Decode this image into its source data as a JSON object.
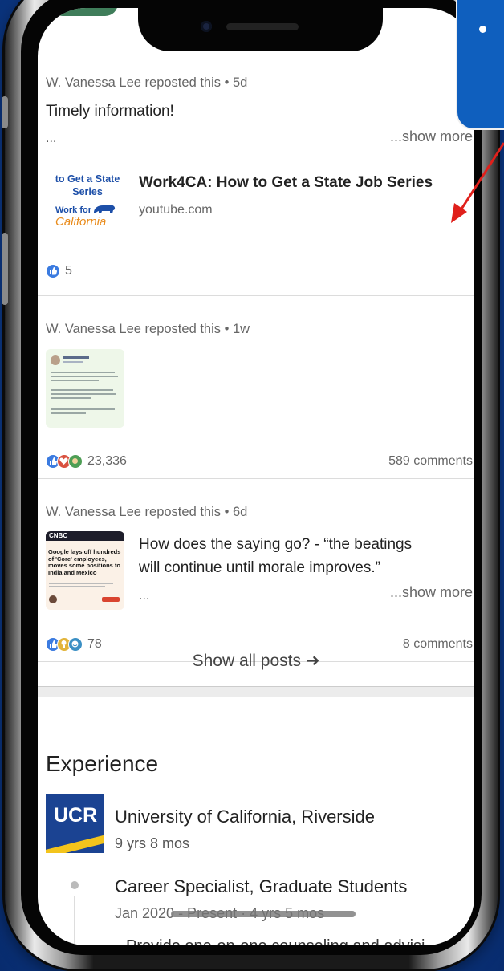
{
  "posts": [
    {
      "author": "W. Vanessa Lee",
      "action": "reposted this",
      "age": "• 5d",
      "text": "Timely information!",
      "ellipsis": "...",
      "show_more": "...show more",
      "link_title": "Work4CA: How to Get a State Job Series",
      "link_domain": "youtube.com",
      "thumb_line1": "to Get a State",
      "thumb_line2": "Series",
      "thumb_line3": "Work for",
      "thumb_line4": "California",
      "reaction_count": "5"
    },
    {
      "author": "W. Vanessa Lee",
      "action": "reposted this",
      "age": "• 1w",
      "reaction_count": "23,336",
      "comments": "589 comments"
    },
    {
      "author": "W. Vanessa Lee",
      "action": "reposted this",
      "age": "• 6d",
      "text_line1": "How does the saying go? - “the beatings",
      "text_line2": "will continue until morale improves.”",
      "ellipsis": "...",
      "show_more": "...show more",
      "thumb_brand": "CNBC",
      "thumb_headline": "Google lays off hundreds of 'Core' employees, moves some positions to India and Mexico",
      "reaction_count": "78",
      "comments": "8 comments"
    }
  ],
  "show_all_posts": "Show all posts ➜",
  "experience": {
    "section_title": "Experience",
    "logo_text": "UCR",
    "org": "University of California, Riverside",
    "duration": "9 yrs 8 mos",
    "role": "Career Specialist, Graduate Students",
    "dates": "Jan 2020 - Present · 4 yrs 5 mos",
    "description": "Provide one-on-one counseling and advisi"
  },
  "colors": {
    "background": "#0e3f94",
    "callout": "#0f5fbe",
    "arrow": "#e0201b",
    "like_blue": "#3b7be0",
    "ucr_blue": "#1b4392",
    "ucr_gold": "#f3c41c"
  }
}
